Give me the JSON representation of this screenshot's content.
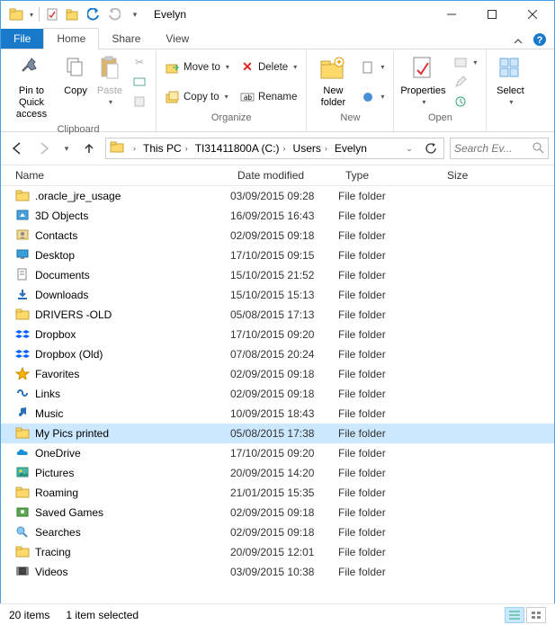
{
  "title": "Evelyn",
  "tabs": {
    "file": "File",
    "home": "Home",
    "share": "Share",
    "view": "View"
  },
  "ribbon": {
    "clipboard": {
      "pin": "Pin to Quick\naccess",
      "copy": "Copy",
      "paste": "Paste",
      "label": "Clipboard"
    },
    "organize": {
      "moveto": "Move to",
      "copyto": "Copy to",
      "delete": "Delete",
      "rename": "Rename",
      "label": "Organize"
    },
    "new": {
      "newfolder": "New\nfolder",
      "label": "New"
    },
    "open": {
      "properties": "Properties",
      "label": "Open"
    },
    "select": {
      "select": "Select",
      "label": ""
    }
  },
  "breadcrumbs": [
    "This PC",
    "TI31411800A (C:)",
    "Users",
    "Evelyn"
  ],
  "search_placeholder": "Search Ev...",
  "columns": {
    "name": "Name",
    "date": "Date modified",
    "type": "Type",
    "size": "Size"
  },
  "rows": [
    {
      "icon": "folder",
      "name": ".oracle_jre_usage",
      "date": "03/09/2015 09:28",
      "type": "File folder"
    },
    {
      "icon": "3d",
      "name": "3D Objects",
      "date": "16/09/2015 16:43",
      "type": "File folder"
    },
    {
      "icon": "contacts",
      "name": "Contacts",
      "date": "02/09/2015 09:18",
      "type": "File folder"
    },
    {
      "icon": "desktop",
      "name": "Desktop",
      "date": "17/10/2015 09:15",
      "type": "File folder"
    },
    {
      "icon": "documents",
      "name": "Documents",
      "date": "15/10/2015 21:52",
      "type": "File folder"
    },
    {
      "icon": "downloads",
      "name": "Downloads",
      "date": "15/10/2015 15:13",
      "type": "File folder"
    },
    {
      "icon": "folder",
      "name": "DRIVERS -OLD",
      "date": "05/08/2015 17:13",
      "type": "File folder"
    },
    {
      "icon": "dropbox",
      "name": "Dropbox",
      "date": "17/10/2015 09:20",
      "type": "File folder"
    },
    {
      "icon": "dropbox",
      "name": "Dropbox (Old)",
      "date": "07/08/2015 20:24",
      "type": "File folder"
    },
    {
      "icon": "favorites",
      "name": "Favorites",
      "date": "02/09/2015 09:18",
      "type": "File folder"
    },
    {
      "icon": "links",
      "name": "Links",
      "date": "02/09/2015 09:18",
      "type": "File folder"
    },
    {
      "icon": "music",
      "name": "Music",
      "date": "10/09/2015 18:43",
      "type": "File folder"
    },
    {
      "icon": "folder",
      "name": "My Pics printed",
      "date": "05/08/2015 17:38",
      "type": "File folder",
      "selected": true
    },
    {
      "icon": "onedrive",
      "name": "OneDrive",
      "date": "17/10/2015 09:20",
      "type": "File folder"
    },
    {
      "icon": "pictures",
      "name": "Pictures",
      "date": "20/09/2015 14:20",
      "type": "File folder"
    },
    {
      "icon": "folder",
      "name": "Roaming",
      "date": "21/01/2015 15:35",
      "type": "File folder"
    },
    {
      "icon": "saved",
      "name": "Saved Games",
      "date": "02/09/2015 09:18",
      "type": "File folder"
    },
    {
      "icon": "searches",
      "name": "Searches",
      "date": "02/09/2015 09:18",
      "type": "File folder"
    },
    {
      "icon": "folder",
      "name": "Tracing",
      "date": "20/09/2015 12:01",
      "type": "File folder"
    },
    {
      "icon": "videos",
      "name": "Videos",
      "date": "03/09/2015 10:38",
      "type": "File folder"
    }
  ],
  "status": {
    "count": "20 items",
    "selected": "1 item selected"
  }
}
